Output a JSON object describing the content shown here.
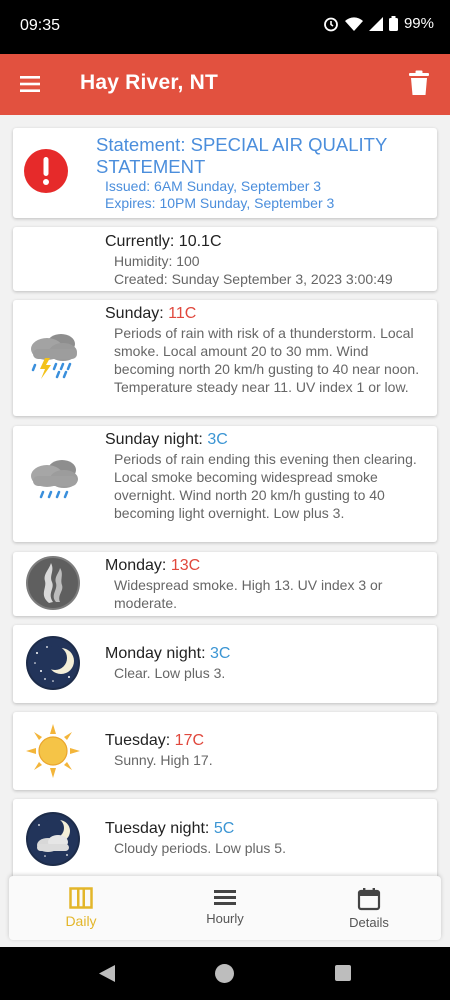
{
  "status_bar": {
    "time": "09:35",
    "battery": "99%",
    "icons": [
      "alarm-icon",
      "wifi-icon",
      "signal-icon",
      "battery-icon"
    ]
  },
  "app_bar": {
    "title": "Hay River, NT",
    "menu_icon": "menu-icon",
    "delete_icon": "delete-icon",
    "background_color": "#e2513f"
  },
  "alert": {
    "title": "Statement: SPECIAL AIR QUALITY STATEMENT",
    "issued": "Issued: 6AM Sunday, September 3",
    "expires": "Expires: 10PM Sunday, September 3",
    "icon": "alert-icon",
    "color": "#4b8edc"
  },
  "current": {
    "label": "Currently: 10.1C",
    "humidity": "Humidity: 100",
    "created": "Created: Sunday September 3, 2023 3:00:49"
  },
  "forecasts": [
    {
      "period": "Sunday:",
      "temp": "11C",
      "temp_type": "high",
      "icon": "rain-thunderstorm-icon",
      "description": "Periods of rain with risk of a thunderstorm. Local smoke. Local amount 20 to 30 mm. Wind becoming north 20 km/h gusting to 40 near noon. Temperature steady near 11. UV index 1 or low."
    },
    {
      "period": "Sunday night:",
      "temp": "3C",
      "temp_type": "low",
      "icon": "rain-cloud-icon",
      "description": "Periods of rain ending this evening then clearing. Local smoke becoming widespread smoke overnight. Wind north 20 km/h gusting to 40 becoming light overnight. Low plus 3."
    },
    {
      "period": "Monday:",
      "temp": "13C",
      "temp_type": "high",
      "icon": "smoke-icon",
      "description": "Widespread smoke. High 13. UV index 3 or moderate."
    },
    {
      "period": "Monday night:",
      "temp": "3C",
      "temp_type": "low",
      "icon": "clear-night-moon-icon",
      "description": "Clear. Low plus 3."
    },
    {
      "period": "Tuesday:",
      "temp": "17C",
      "temp_type": "high",
      "icon": "sun-icon",
      "description": "Sunny. High 17."
    },
    {
      "period": "Tuesday night:",
      "temp": "5C",
      "temp_type": "low",
      "icon": "cloudy-night-icon",
      "description": "Cloudy periods. Low plus 5."
    }
  ],
  "colors": {
    "high_temp": "#e0483d",
    "low_temp": "#3b95d3",
    "active_nav": "#e3b62a"
  },
  "bottom_nav": {
    "items": [
      {
        "label": "Daily",
        "icon": "calendar-columns-icon",
        "active": true
      },
      {
        "label": "Hourly",
        "icon": "list-icon",
        "active": false
      },
      {
        "label": "Details",
        "icon": "calendar-icon",
        "active": false
      }
    ]
  },
  "system_nav": {
    "icons": [
      "back-icon",
      "home-icon",
      "recents-icon"
    ]
  }
}
